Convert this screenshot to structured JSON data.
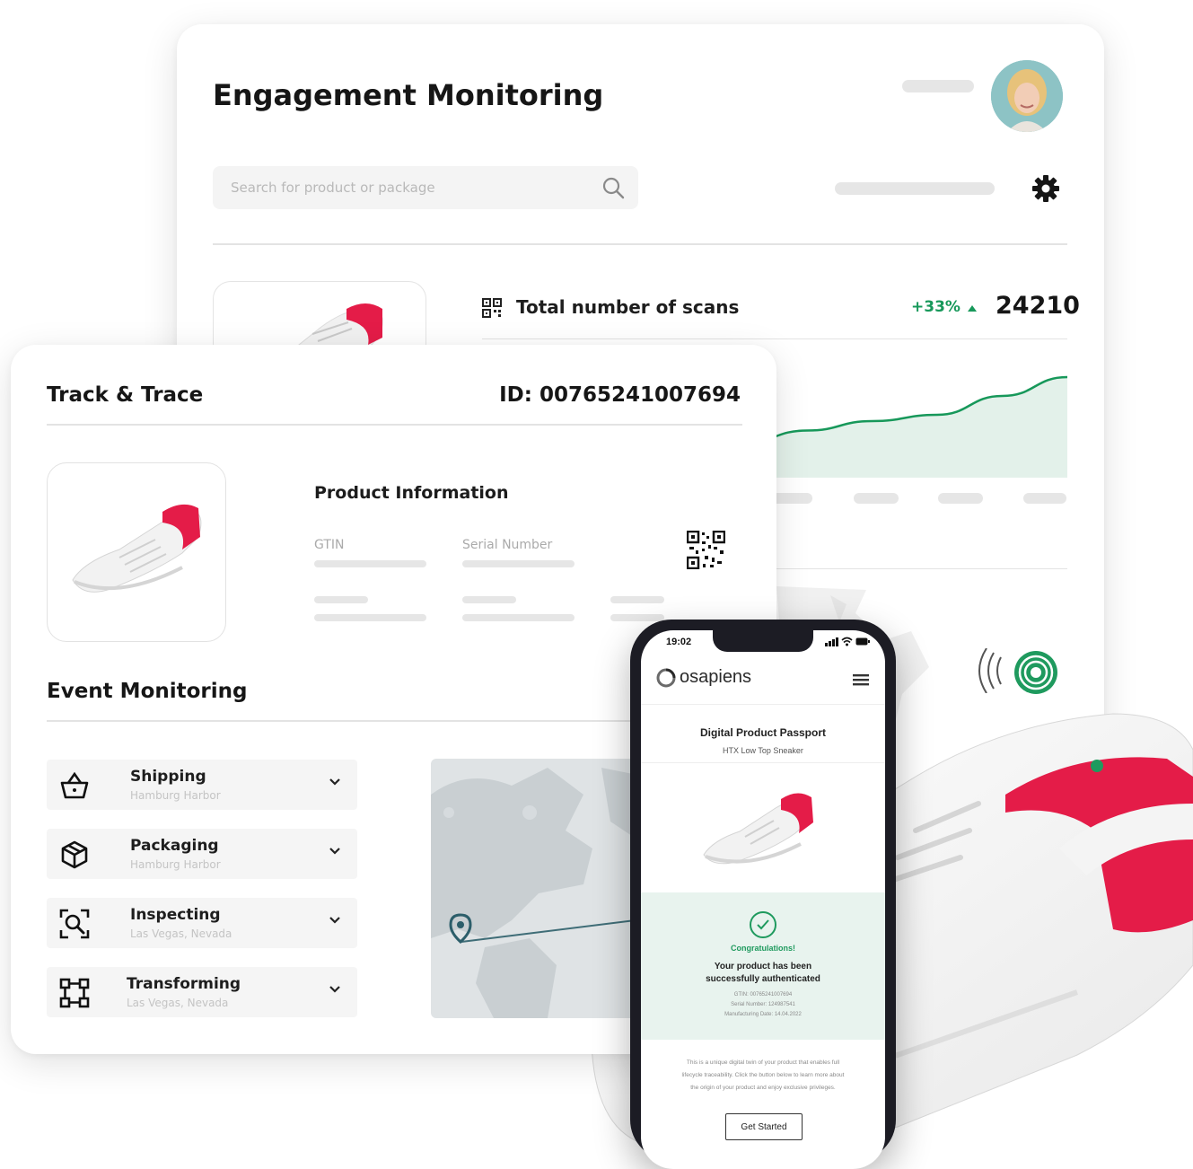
{
  "engagement": {
    "title": "Engagement Monitoring",
    "search_placeholder": "Search for product or package",
    "scans_label": "Total number of scans",
    "scans_change": "+33%",
    "scans_total": "24210",
    "colors": {
      "accent": "#17985a",
      "area": "#e3f1ea"
    }
  },
  "chart_data": {
    "type": "area",
    "title": "",
    "x": [
      0,
      1,
      2,
      3,
      4,
      5,
      6,
      7,
      8,
      9
    ],
    "values": [
      10,
      11,
      12,
      16,
      22,
      30,
      36,
      40,
      52,
      64
    ],
    "ylim": [
      0,
      80
    ],
    "grid": false
  },
  "track": {
    "title": "Track & Trace",
    "id_label": "ID: 00765241007694",
    "product_info_title": "Product Information",
    "gtin_label": "GTIN",
    "serial_label": "Serial Number"
  },
  "events": {
    "title": "Event Monitoring",
    "items": [
      {
        "title": "Shipping",
        "location": "Hamburg Harbor",
        "icon": "basket-icon"
      },
      {
        "title": "Packaging",
        "location": "Hamburg Harbor",
        "icon": "package-icon"
      },
      {
        "title": "Inspecting",
        "location": "Las Vegas, Nevada",
        "icon": "scan-search-icon"
      },
      {
        "title": "Transforming",
        "location": "Las Vegas, Nevada",
        "icon": "transform-icon"
      }
    ]
  },
  "phone": {
    "time": "19:02",
    "brand": "osapiens",
    "passport_title": "Digital Product Passport",
    "product_name": "HTX Low Top Sneaker",
    "congrats": "Congratulations!",
    "auth_line1": "Your product has been",
    "auth_line2": "successfully authenticated",
    "details": [
      "GTIN: 00765241007694",
      "Serial Number: 124987541",
      "Manufacturing Date: 14.04.2022"
    ],
    "description": [
      "This is a unique digital twin of your product that enables full",
      "lifecycle traceability. Click the button below to learn more about",
      "the origin of your product and enjoy exclusive privileges."
    ],
    "cta": "Get Started",
    "colors": {
      "accent": "#1f9a5e",
      "auth_bg": "#e8f3ee"
    }
  },
  "shoe_accent": "#e41c48"
}
